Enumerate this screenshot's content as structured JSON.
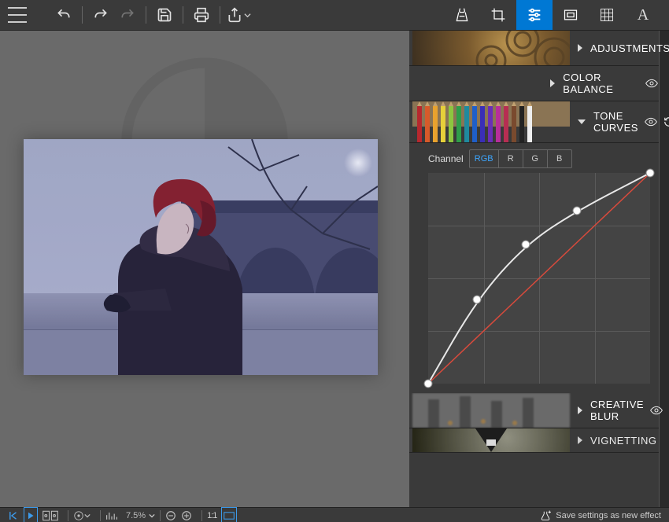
{
  "panels": {
    "adjustments": {
      "label": "ADJUSTMENTS"
    },
    "colorbalance": {
      "label": "COLOR BALANCE"
    },
    "tonecurves": {
      "label": "TONE CURVES"
    },
    "creativeblur": {
      "label": "CREATIVE BLUR"
    },
    "vignetting": {
      "label": "VIGNETTING"
    }
  },
  "tonecurves": {
    "channel_label": "Channel",
    "channels": {
      "rgb": "RGB",
      "r": "R",
      "g": "G",
      "b": "B"
    },
    "active_channel": "RGB",
    "curve_points": [
      {
        "x": 0.0,
        "y": 0.0
      },
      {
        "x": 0.22,
        "y": 0.4
      },
      {
        "x": 0.44,
        "y": 0.66
      },
      {
        "x": 0.67,
        "y": 0.82
      },
      {
        "x": 1.0,
        "y": 1.0
      }
    ]
  },
  "zoom": {
    "value": "7.5%"
  },
  "bottombar": {
    "save_text": "Save settings as new effect"
  }
}
